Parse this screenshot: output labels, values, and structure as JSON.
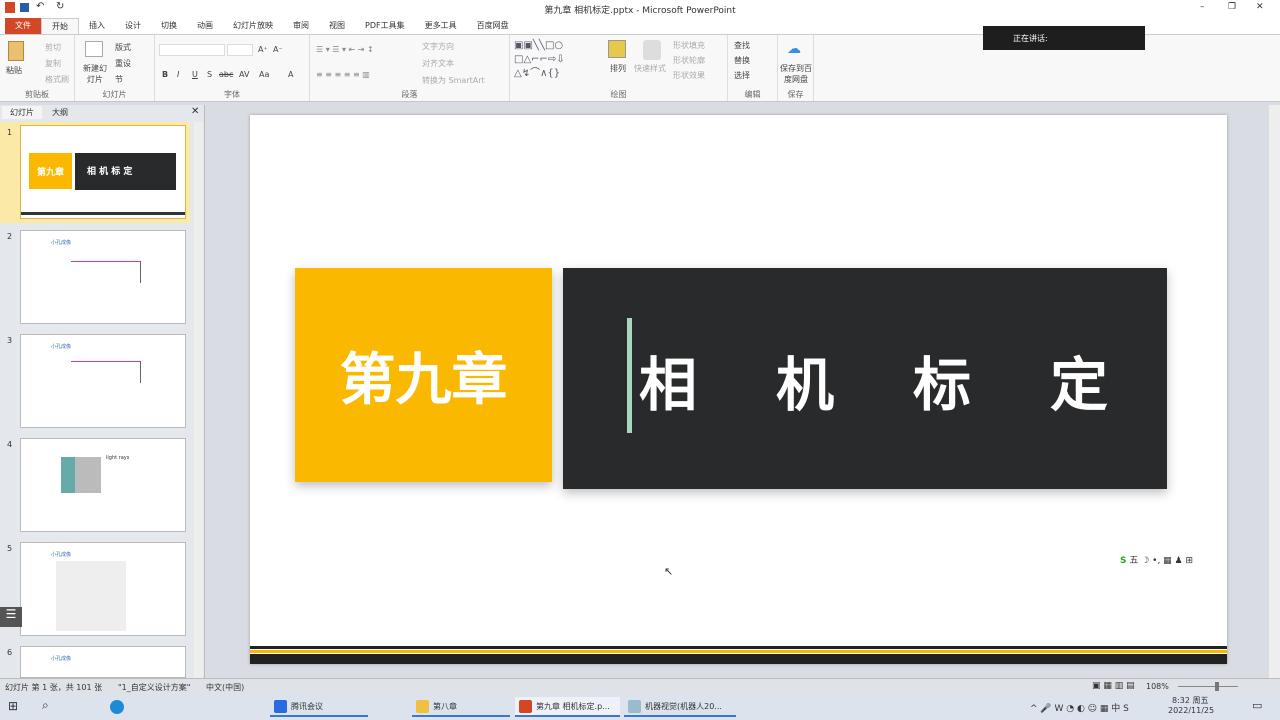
{
  "window": {
    "title": "第九章 相机标定.pptx - Microsoft PowerPoint",
    "minimize": "–",
    "restore": "❐",
    "close": "✕"
  },
  "tabs": [
    "文件",
    "开始",
    "插入",
    "设计",
    "切换",
    "动画",
    "幻灯片放映",
    "审阅",
    "视图",
    "PDF工具集",
    "更多工具",
    "百度网盘"
  ],
  "ribbon": {
    "clipboard": {
      "paste": "粘贴",
      "cut": "剪切",
      "copy": "复制",
      "format_painter": "格式刷",
      "label": "剪贴板"
    },
    "slides": {
      "new_slide": "新建幻灯片",
      "layout": "版式",
      "reset": "重设",
      "section": "节",
      "label": "幻灯片"
    },
    "font": {
      "bold": "B",
      "italic": "I",
      "underline": "U",
      "shadow": "S",
      "strike": "abc",
      "spacing": "AV",
      "case": "Aa",
      "color": "A",
      "grow": "A⁺",
      "shrink": "A⁻",
      "label": "字体"
    },
    "paragraph": {
      "text_direction": "文字方向",
      "align_text": "对齐文本",
      "smartart": "转换为 SmartArt",
      "label": "段落"
    },
    "drawing": {
      "arrange": "排列",
      "quick_styles": "快速样式",
      "fill": "形状填充",
      "outline": "形状轮廓",
      "effects": "形状效果",
      "label": "绘图"
    },
    "editing": {
      "find": "查找",
      "replace": "替换",
      "select": "选择",
      "label": "编辑"
    },
    "save": {
      "save_baidu": "保存到百度网盘",
      "label": "保存"
    }
  },
  "meeting_overlay": {
    "speaking": "正在讲话:"
  },
  "pane": {
    "tab_slides": "幻灯片",
    "tab_outline": "大纲",
    "close": "✕",
    "thumbs": [
      {
        "num": "1",
        "title": "第九章",
        "sub": "相  机  标  定"
      },
      {
        "num": "2",
        "title": "小孔成像"
      },
      {
        "num": "3",
        "title": "小孔成像"
      },
      {
        "num": "4",
        "title": "light rays"
      },
      {
        "num": "5",
        "title": "小孔成像"
      },
      {
        "num": "6",
        "title": "小孔成像"
      }
    ]
  },
  "slide": {
    "chapter": "第九章",
    "chars": [
      "相",
      "机",
      "标",
      "定"
    ]
  },
  "status": {
    "slide_info": "幻灯片 第 1 张，共 101 张",
    "theme": "\"1_自定义设计方案\"",
    "lang": "中文(中国)",
    "zoom": "108%"
  },
  "taskbar": {
    "apps": [
      "腾讯会议",
      "第八章",
      "第九章 相机标定.p...",
      "机器视觉(机器人20..."
    ],
    "time": "8:32 周五",
    "date": "2022/11/25"
  }
}
